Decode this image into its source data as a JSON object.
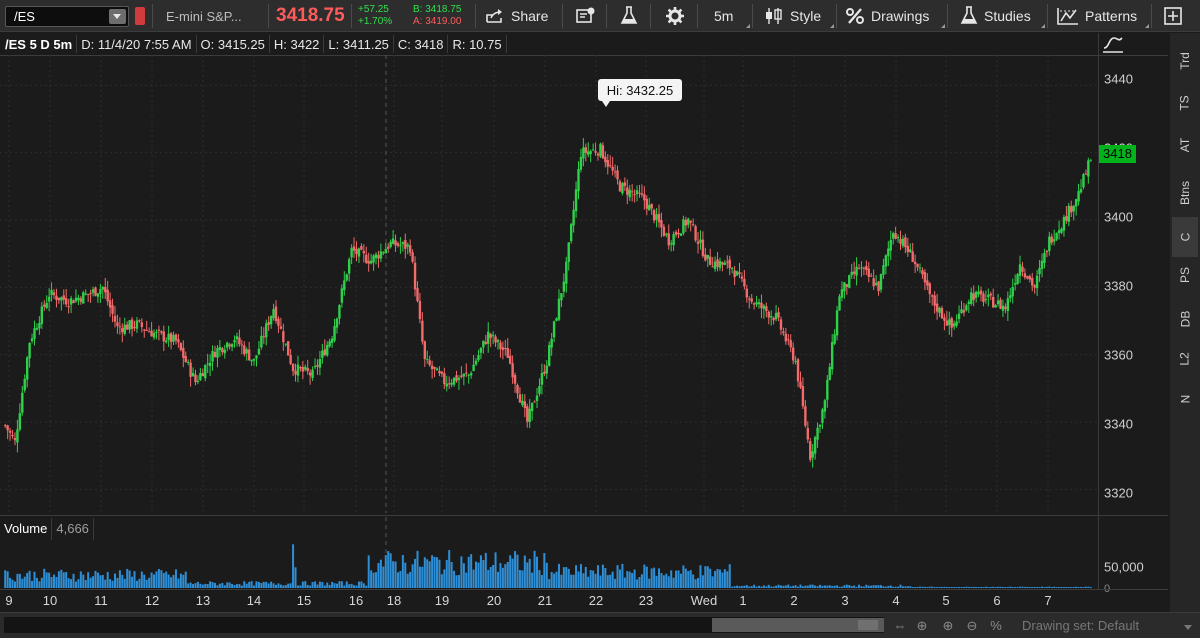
{
  "toolbar": {
    "symbol": "/ES",
    "description": "E-mini S&P...",
    "last_price": "3418.75",
    "net_change": "+57.25",
    "pct_change": "+1.70%",
    "bid": "B: 3418.75",
    "ask": "A: 3419.00",
    "share_label": "Share",
    "timeframe_label": "5m",
    "style_label": "Style",
    "drawings_label": "Drawings",
    "studies_label": "Studies",
    "patterns_label": "Patterns"
  },
  "info_bar": {
    "symbol": "/ES 5 D 5m",
    "date": "D: 11/4/20 7:55 AM",
    "open": "O: 3415.25",
    "high": "H: 3422",
    "low": "L: 3411.25",
    "close": "C: 3418",
    "range": "R: 10.75"
  },
  "price_axis": {
    "ticks": [
      "3440",
      "3420",
      "3400",
      "3380",
      "3360",
      "3340",
      "3320"
    ],
    "last_price_tag": "3418"
  },
  "high_bubble": "Hi: 3432.25",
  "volume_panel": {
    "label": "Volume",
    "value": "4,666",
    "axis_ticks": [
      "50,000",
      "0"
    ]
  },
  "time_axis": {
    "labels": [
      "9",
      "10",
      "11",
      "12",
      "13",
      "14",
      "15",
      "16",
      "18",
      "19",
      "20",
      "21",
      "22",
      "23",
      "Wed",
      "1",
      "2",
      "3",
      "4",
      "5",
      "6",
      "7"
    ]
  },
  "side_tabs": [
    "Trd",
    "TS",
    "AT",
    "Btns",
    "C",
    "PS",
    "DB",
    "L2",
    "N"
  ],
  "side_tabs_active": "C",
  "bottom_bar": {
    "drawing_set": "Drawing set: Default"
  },
  "colors": {
    "up": "#2fd14a",
    "down": "#f26a6a",
    "volume": "#2f8fd6",
    "last_tag": "#00b31a",
    "price_text": "#ff5b5b"
  },
  "chart_data": {
    "type": "candlestick",
    "title": "",
    "ylim": [
      3313,
      3449
    ],
    "y_ticks": [
      3320,
      3340,
      3360,
      3380,
      3400,
      3420,
      3440
    ],
    "x_labels": [
      "9",
      "10",
      "11",
      "12",
      "13",
      "14",
      "15",
      "16",
      "18",
      "19",
      "20",
      "21",
      "22",
      "23",
      "Wed",
      "1",
      "2",
      "3",
      "4",
      "5",
      "6",
      "7"
    ],
    "high": 3432.25,
    "last": 3418,
    "close_path": [
      [
        0,
        3339
      ],
      [
        4,
        3334
      ],
      [
        10,
        3364
      ],
      [
        18,
        3378
      ],
      [
        26,
        3376
      ],
      [
        34,
        3378
      ],
      [
        40,
        3380
      ],
      [
        46,
        3368
      ],
      [
        54,
        3369
      ],
      [
        62,
        3366
      ],
      [
        70,
        3364
      ],
      [
        78,
        3352
      ],
      [
        86,
        3361
      ],
      [
        94,
        3365
      ],
      [
        102,
        3358
      ],
      [
        110,
        3374
      ],
      [
        118,
        3356
      ],
      [
        126,
        3354
      ],
      [
        134,
        3366
      ],
      [
        142,
        3391
      ],
      [
        150,
        3388
      ],
      [
        158,
        3393
      ],
      [
        166,
        3392
      ],
      [
        172,
        3358
      ],
      [
        180,
        3352
      ],
      [
        190,
        3354
      ],
      [
        198,
        3366
      ],
      [
        206,
        3360
      ],
      [
        214,
        3340
      ],
      [
        222,
        3358
      ],
      [
        230,
        3386
      ],
      [
        236,
        3420
      ],
      [
        244,
        3421
      ],
      [
        252,
        3410
      ],
      [
        262,
        3406
      ],
      [
        272,
        3394
      ],
      [
        280,
        3400
      ],
      [
        288,
        3388
      ],
      [
        298,
        3386
      ],
      [
        306,
        3376
      ],
      [
        316,
        3371
      ],
      [
        324,
        3358
      ],
      [
        330,
        3330
      ],
      [
        336,
        3346
      ],
      [
        342,
        3378
      ],
      [
        350,
        3386
      ],
      [
        358,
        3380
      ],
      [
        364,
        3397
      ],
      [
        372,
        3389
      ],
      [
        380,
        3376
      ],
      [
        388,
        3368
      ],
      [
        396,
        3378
      ],
      [
        404,
        3376
      ],
      [
        410,
        3374
      ],
      [
        416,
        3387
      ],
      [
        422,
        3380
      ],
      [
        428,
        3394
      ],
      [
        434,
        3400
      ],
      [
        440,
        3408
      ],
      [
        445,
        3418
      ]
    ],
    "volume_levels": [
      0.28,
      0.1,
      0.55,
      0.35,
      0.05,
      0.02
    ]
  }
}
